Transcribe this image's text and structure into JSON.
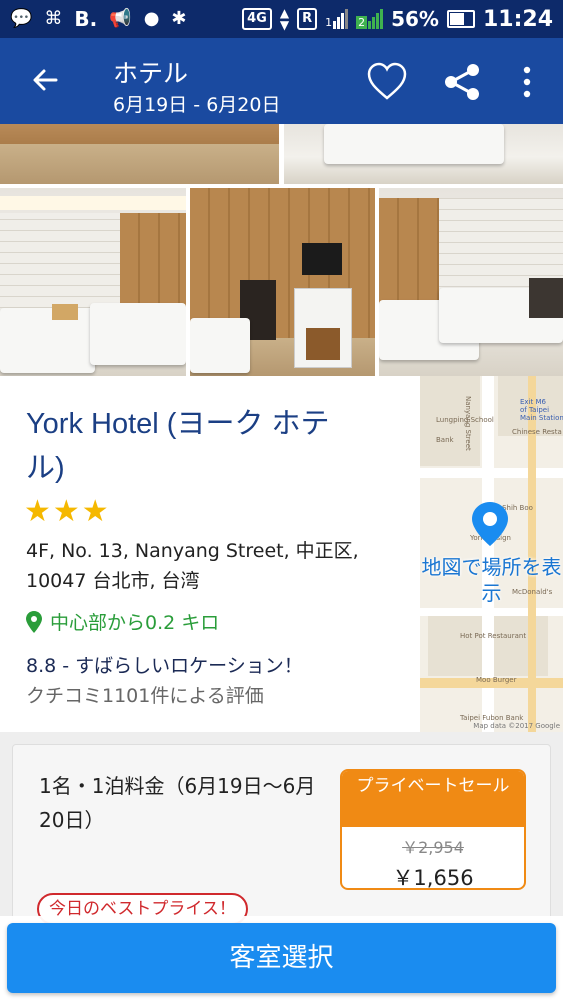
{
  "status_bar": {
    "carrier_letter": "B.",
    "network": "4G",
    "roaming": "R",
    "sim1": "1",
    "sim2": "2",
    "battery_pct": "56%",
    "time": "11:24"
  },
  "app_bar": {
    "title": "ホテル",
    "dates": "6月19日 - 6月20日",
    "icons": [
      "back-arrow-icon",
      "heart-icon",
      "share-icon",
      "more-vert-icon"
    ]
  },
  "hotel": {
    "name": "York Hotel (ヨーク ホテル)",
    "stars": "★★★",
    "address": "4F, No. 13, Nanyang Street, 中正区, 10047 台北市, 台湾",
    "distance": "中心部から0.2 キロ",
    "rating": "8.8 - すばらしいロケーション！",
    "review_count": "クチコミ1101件による評価"
  },
  "map": {
    "label": "地図で場所を表示",
    "copyright": "Map data ©2017 Google",
    "labels": [
      "Exit M6",
      "of Taipei",
      "Main Station",
      "Chinese Resta",
      "Hot Pot Restaurant",
      "Moo Burger",
      "Taipei Fubon Bank",
      "McDonald's",
      "Chiao Shih Boo",
      "York Design",
      "Nanyang Street",
      "Lungping School",
      "Bank"
    ]
  },
  "offer": {
    "rate_label": "1名・1泊料金（6月19日〜6月20日）",
    "sale_label": "プライベートセール",
    "original_price": "￥2,954",
    "price": "￥1,656",
    "best_price_badge": "今日のベストプライス！"
  },
  "cta": {
    "select_room": "客室選択"
  },
  "colors": {
    "status_bar": "#0d2a6a",
    "app_bar": "#1a4aa0",
    "hotel_name": "#1b3f84",
    "star": "#f5b800",
    "distance": "#2a9d3a",
    "sale": "#f08a14",
    "best_price": "#d0292d",
    "cta": "#1a8cf0"
  }
}
